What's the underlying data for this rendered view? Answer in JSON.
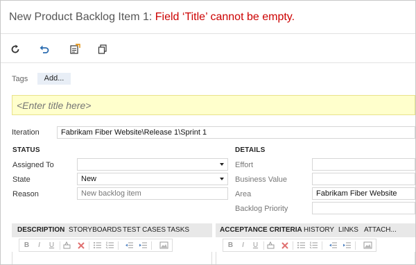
{
  "header": {
    "title_prefix": "New Product Backlog Item 1:",
    "title_error": "Field ‘Title’ cannot be empty."
  },
  "toolbar": {
    "buttons": [
      {
        "name": "refresh-icon"
      },
      {
        "name": "undo-icon"
      },
      {
        "name": "save-icon"
      },
      {
        "name": "copy-icon"
      }
    ]
  },
  "tags": {
    "label": "Tags",
    "add_label": "Add..."
  },
  "title_field": {
    "placeholder": "<Enter title here>",
    "value": ""
  },
  "iteration": {
    "label": "Iteration",
    "value": "Fabrikam Fiber Website\\Release 1\\Sprint 1"
  },
  "status": {
    "heading": "STATUS",
    "assigned_to": {
      "label": "Assigned To",
      "value": ""
    },
    "state": {
      "label": "State",
      "value": "New"
    },
    "reason": {
      "label": "Reason",
      "value": "New backlog item"
    }
  },
  "details": {
    "heading": "DETAILS",
    "effort": {
      "label": "Effort",
      "value": ""
    },
    "business_value": {
      "label": "Business Value",
      "value": ""
    },
    "area": {
      "label": "Area",
      "value": "Fabrikam Fiber Website"
    },
    "backlog_priority": {
      "label": "Backlog Priority",
      "value": ""
    }
  },
  "left_tabs": [
    {
      "label": "DESCRIPTION",
      "active": true
    },
    {
      "label": "STORYBOARDS",
      "active": false
    },
    {
      "label": "TEST CASES",
      "active": false
    },
    {
      "label": "TASKS",
      "active": false
    }
  ],
  "right_tabs": [
    {
      "label": "ACCEPTANCE CRITERIA",
      "active": true
    },
    {
      "label": "HISTORY",
      "active": false
    },
    {
      "label": "LINKS",
      "active": false
    },
    {
      "label": "ATTACH...",
      "active": false
    }
  ],
  "editor_toolbar": {
    "bold": "B",
    "italic": "I",
    "underline": "U"
  },
  "colors": {
    "error": "#cc0000",
    "title_bg": "#ffffcc",
    "tab_bg": "#e8e8e8",
    "tags_add_bg": "#e8eef6"
  }
}
